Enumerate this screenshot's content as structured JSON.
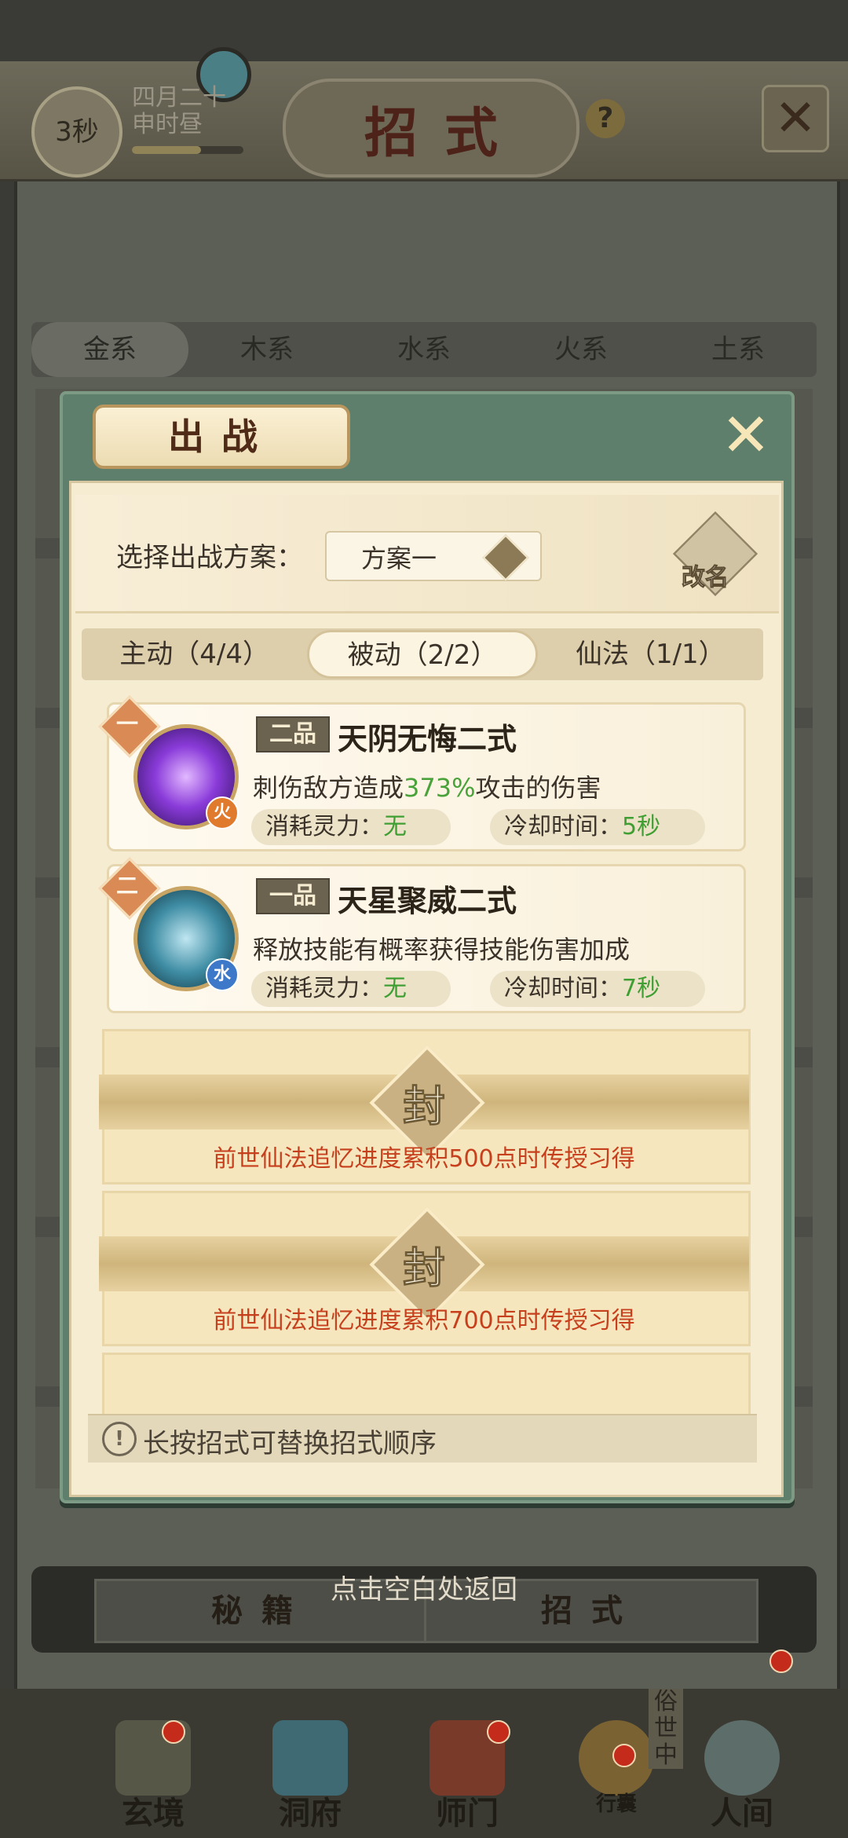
{
  "header": {
    "timer": "3秒",
    "date_line1": "四月二十",
    "date_line2": "申时昼",
    "title": "招式",
    "help_glyph": "?",
    "close_glyph": "✕"
  },
  "element_tabs": [
    "金系",
    "木系",
    "水系",
    "火系",
    "土系"
  ],
  "bottom_tabs": {
    "left": "秘籍",
    "right": "招式"
  },
  "tap_hint": "点击空白处返回",
  "nav": {
    "items": [
      "玄境",
      "洞府",
      "师门",
      "行囊",
      "人间"
    ],
    "side_label": "俗世中"
  },
  "modal": {
    "title": "出战",
    "close_glyph": "✕",
    "plan_label": "选择出战方案：",
    "plan_value": "方案一",
    "rename_label": "改名",
    "tabs": [
      "主动（4/4）",
      "被动（2/2）",
      "仙法（1/1）"
    ],
    "active_tab_index": 1,
    "skills": [
      {
        "order": "一",
        "grade": "二品",
        "name": "天阴无悔二式",
        "desc_before": "刺伤敌方造成",
        "desc_highlight": "373%",
        "desc_after": "攻击的伤害",
        "element": "火",
        "cost_label": "消耗灵力：",
        "cost_value": "无",
        "cooldown_label": "冷却时间：",
        "cooldown_value": "5秒"
      },
      {
        "order": "二",
        "grade": "一品",
        "name": "天星聚威二式",
        "desc_before": "释放技能有概率获得技能伤害加成",
        "desc_highlight": "",
        "desc_after": "",
        "element": "水",
        "cost_label": "消耗灵力：",
        "cost_value": "无",
        "cooldown_label": "冷却时间：",
        "cooldown_value": "7秒"
      }
    ],
    "sealed": [
      {
        "seal_char": "封",
        "caption": "前世仙法追忆进度累积500点时传授习得"
      },
      {
        "seal_char": "封",
        "caption": "前世仙法追忆进度累积700点时传授习得"
      }
    ],
    "hint": "长按招式可替换招式顺序",
    "hint_icon": "!"
  },
  "colors": {
    "modal_green": "#5d7f6c",
    "paper": "#f6ecd2",
    "accent_red": "#c6401e",
    "value_green": "#3f9f33",
    "fire": "#e07a2c",
    "water": "#3e78c9"
  },
  "icons": [
    "clock-icon",
    "help-icon",
    "close-icon",
    "rename-icon",
    "dropdown-icon",
    "seal-icon",
    "info-icon"
  ]
}
